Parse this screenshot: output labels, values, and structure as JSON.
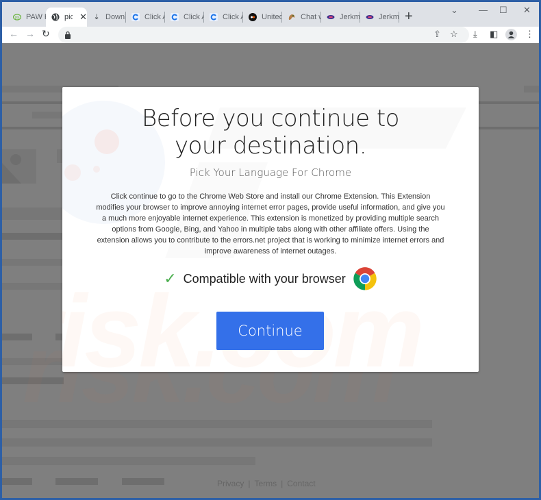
{
  "browser": {
    "tabs": [
      {
        "label": "PAW P",
        "icon": "pts-icon",
        "active": false
      },
      {
        "label": "pic",
        "icon": "globe-icon",
        "active": true
      },
      {
        "label": "Downl",
        "icon": "download-icon",
        "active": false
      },
      {
        "label": "Click A",
        "icon": "click-icon",
        "active": false
      },
      {
        "label": "Click A",
        "icon": "click-icon",
        "active": false
      },
      {
        "label": "Click A",
        "icon": "click-icon",
        "active": false
      },
      {
        "label": "United",
        "icon": "dark-circle-icon",
        "active": false
      },
      {
        "label": "Chat w",
        "icon": "squirrel-icon",
        "active": false
      },
      {
        "label": "Jerkm",
        "icon": "jerk-icon",
        "active": false
      },
      {
        "label": "Jerkm",
        "icon": "jerk-icon",
        "active": false
      }
    ],
    "new_tab_label": "+",
    "close_tab_label": "✕",
    "window_controls": {
      "tab_search": "⌄",
      "minimize": "—",
      "maximize": "☐",
      "close": "✕"
    },
    "nav": {
      "back": "←",
      "forward": "→",
      "reload": "↻"
    },
    "url": "",
    "toolbar_icons": {
      "share": "⇪",
      "star": "☆",
      "downloads": "⤓",
      "sidepanel": "◧",
      "profile": "●",
      "menu": "⋮"
    }
  },
  "modal": {
    "title": "Before you continue to your destination.",
    "subtitle": "Pick Your Language For Chrome",
    "body": "Click continue to go to the Chrome Web Store and install our Chrome Extension. This Extension modifies your browser to improve annoying internet error pages, provide useful information, and give you a much more enjoyable internet experience. This extension is monetized by providing multiple search options from Google, Bing, and Yahoo in multiple tabs along with other affiliate offers. Using the extension allows you to contribute to the errors.net project that is working to minimize internet errors and improve awareness of internet outages.",
    "compat_check": "✓",
    "compat_text": "Compatible with your browser",
    "continue_label": "Continue",
    "button_color": "#3470e9"
  },
  "footer": {
    "links": [
      "Privacy",
      "Terms",
      "Contact"
    ],
    "separator": "|"
  },
  "watermark": "risk.com"
}
